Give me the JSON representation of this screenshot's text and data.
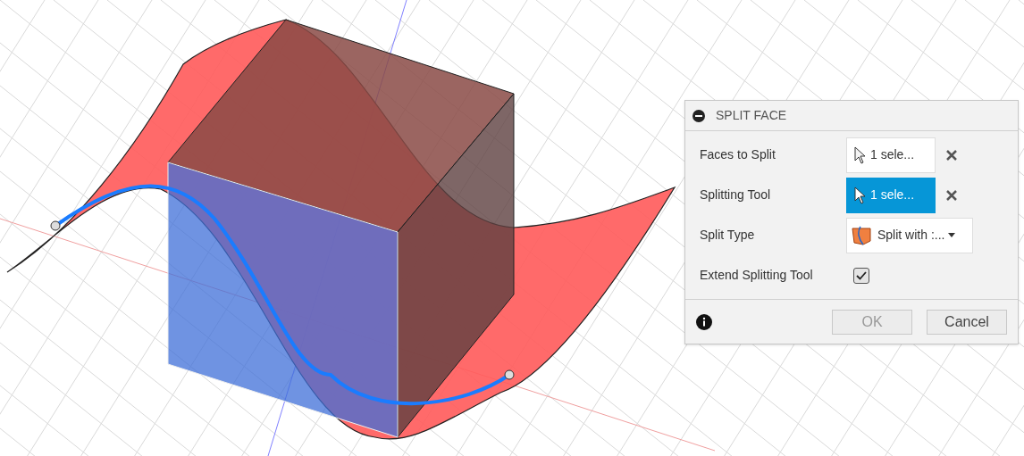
{
  "dialog": {
    "title": "SPLIT FACE",
    "expanded": true,
    "rows": [
      {
        "kind": "selection",
        "label": "Faces to Split",
        "value": "1 sele...",
        "selected": false
      },
      {
        "kind": "selection",
        "label": "Splitting Tool",
        "value": "1 sele...",
        "selected": true
      },
      {
        "kind": "dropdown",
        "label": "Split Type",
        "value": "Split with :..."
      },
      {
        "kind": "checkbox",
        "label": "Extend Splitting Tool",
        "checked": true
      }
    ],
    "buttons": [
      {
        "label": "OK",
        "disabled": true
      },
      {
        "label": "Cancel",
        "disabled": false
      }
    ]
  }
}
